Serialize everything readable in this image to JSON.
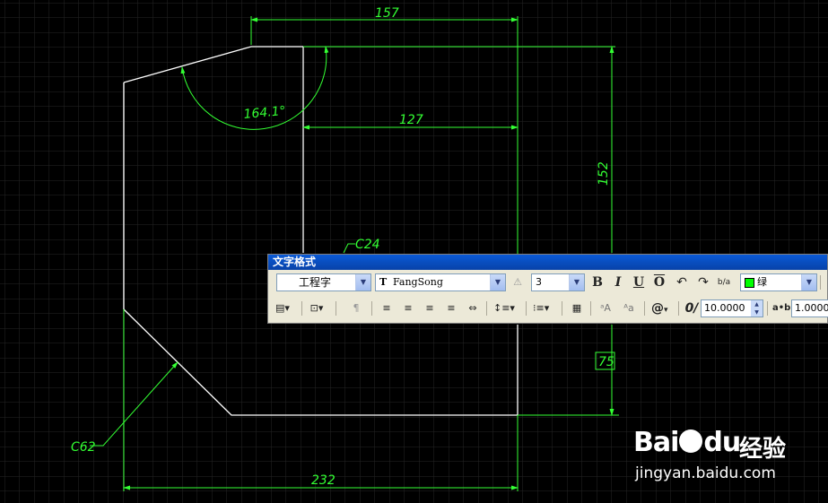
{
  "drawing": {
    "dimensions": {
      "top_width": "157",
      "angle": "164.1°",
      "inner_width": "127",
      "right_height": "152",
      "bottom_right_height": "75",
      "chamfer_small": "C24",
      "chamfer_large": "C62",
      "bottom_width": "232"
    },
    "colors": {
      "background": "#000000",
      "grid": "#2a2a2a",
      "dimension": "#33ff33",
      "outline": "#ffffff"
    }
  },
  "toolbar": {
    "title": "文字格式",
    "style_value": "工程字",
    "font_icon": "T",
    "font_value": "FangSong",
    "height_value": "3",
    "bold": "B",
    "italic": "I",
    "underline": "U",
    "overline": "O",
    "undo": "↶",
    "redo": "↷",
    "stack": "b/a",
    "color_value": "绿",
    "obliquing_value": "10.0000",
    "tracking_value": "1.0000",
    "symbol": "@"
  },
  "watermark": {
    "brand": "Bai",
    "brand_suffix": "du",
    "product": "经验",
    "url": "jingyan.baidu.com"
  }
}
